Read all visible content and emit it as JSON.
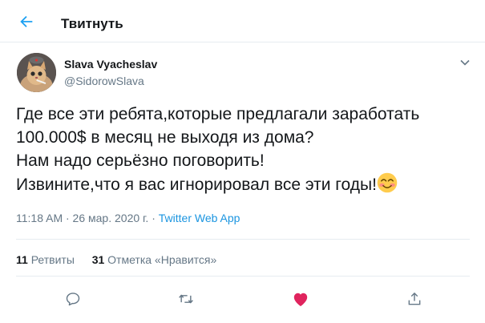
{
  "header": {
    "back_icon": "arrow-left-icon",
    "title": "Твитнуть"
  },
  "tweet": {
    "author": {
      "name": "Slava Vyacheslav",
      "handle": "@SidorowSlava",
      "avatar_icon": "cat-avatar"
    },
    "text_lines": [
      "Где все эти ребята,которые предлагали заработать",
      "100.000$ в месяц не выходя из дома?",
      "Нам надо серьёзно поговорить!",
      "Извините,что я вас игнорировал все эти годы!"
    ],
    "emoji": "smiling-face-with-smiling-eyes",
    "timestamp": "11:18 AM · 26 мар. 2020 г.",
    "separator": " · ",
    "source": "Twitter Web App",
    "stats": {
      "retweets_count": "11",
      "retweets_label": "Ретвиты",
      "likes_count": "31",
      "likes_label": "Отметка «Нравится»"
    }
  },
  "actions": {
    "reply_icon": "reply-icon",
    "retweet_icon": "retweet-icon",
    "like_icon": "heart-icon",
    "share_icon": "share-icon",
    "like_color": "#e0245e",
    "icon_color": "#657786",
    "accent_color": "#1da1f2"
  }
}
